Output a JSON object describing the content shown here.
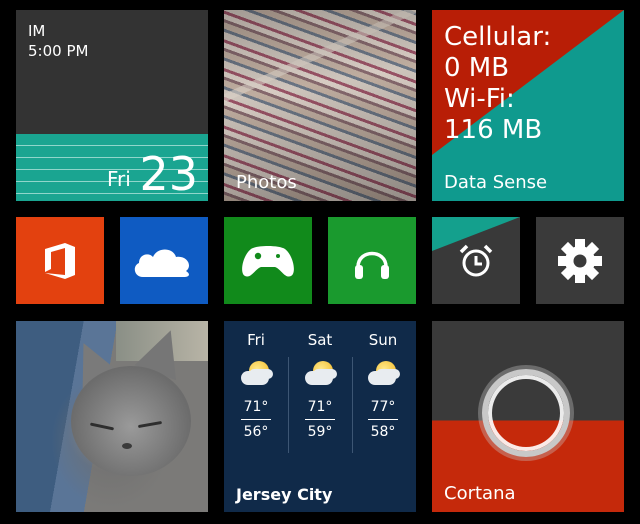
{
  "calendar": {
    "event_name": "IM",
    "event_time": "5:00 PM",
    "day": "Fri",
    "date": "23"
  },
  "photos": {
    "label": "Photos"
  },
  "data_sense": {
    "label": "Data Sense",
    "lines": [
      "Cellular:",
      "0 MB",
      "Wi-Fi:",
      "116 MB"
    ]
  },
  "weather": {
    "city": "Jersey City",
    "days": [
      {
        "day": "Fri",
        "high": "71°",
        "low": "56°"
      },
      {
        "day": "Sat",
        "high": "71°",
        "low": "59°"
      },
      {
        "day": "Sun",
        "high": "77°",
        "low": "58°"
      }
    ]
  },
  "cortana": {
    "label": "Cortana"
  },
  "colors": {
    "office": "#e3410f",
    "onedrive": "#0f5bc2",
    "xbox": "#118a1b",
    "music": "#1a9a2e",
    "accent_teal": "#1aa591",
    "cortana": "#c5290b",
    "weather": "#102a49"
  },
  "icons": [
    "office-icon",
    "onedrive-icon",
    "xbox-icon",
    "music-icon",
    "alarm-icon",
    "settings-icon"
  ]
}
